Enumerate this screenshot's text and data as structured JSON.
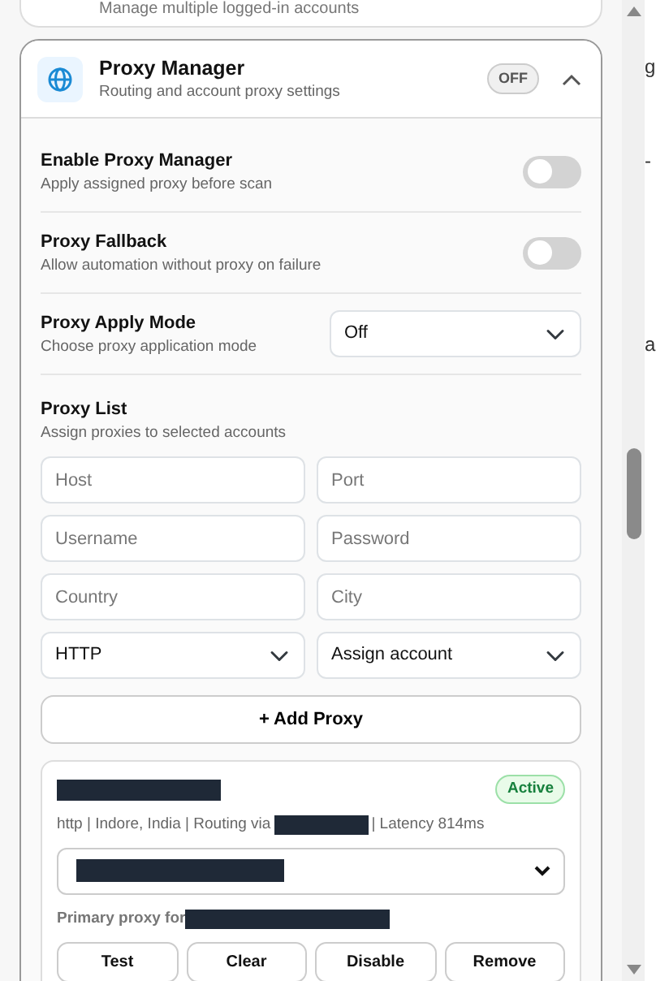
{
  "previous_section": {
    "subtitle": "Manage multiple logged-in accounts"
  },
  "section": {
    "title": "Proxy Manager",
    "subtitle": "Routing and account proxy settings",
    "status_badge": "OFF",
    "expanded": true
  },
  "settings": [
    {
      "kind": "toggle",
      "label": "Enable Proxy Manager",
      "description": "Apply assigned proxy before scan",
      "on": false
    },
    {
      "kind": "toggle",
      "label": "Proxy Fallback",
      "description": "Allow automation without proxy on failure",
      "on": false
    },
    {
      "kind": "select",
      "label": "Proxy Apply Mode",
      "description": "Choose proxy application mode",
      "value": "Off"
    }
  ],
  "proxy_list": {
    "title": "Proxy List",
    "subtitle": "Assign proxies to selected accounts",
    "fields": [
      {
        "kind": "input",
        "placeholder": "Host"
      },
      {
        "kind": "input",
        "placeholder": "Port"
      },
      {
        "kind": "input",
        "placeholder": "Username"
      },
      {
        "kind": "input",
        "placeholder": "Password"
      },
      {
        "kind": "input",
        "placeholder": "Country"
      },
      {
        "kind": "input",
        "placeholder": "City"
      },
      {
        "kind": "select",
        "value": "HTTP"
      },
      {
        "kind": "select",
        "value": "Assign account"
      }
    ],
    "add_button": "+ Add Proxy",
    "proxies": [
      {
        "status": "Active",
        "details_before": "http | Indore, India | Routing via",
        "details_after": "| Latency 814ms",
        "primary_label": "Primary proxy for",
        "actions": [
          "Test",
          "Clear",
          "Disable",
          "Remove"
        ]
      }
    ]
  },
  "background_page": {
    "fragments": [
      "g",
      "-",
      "a"
    ]
  }
}
